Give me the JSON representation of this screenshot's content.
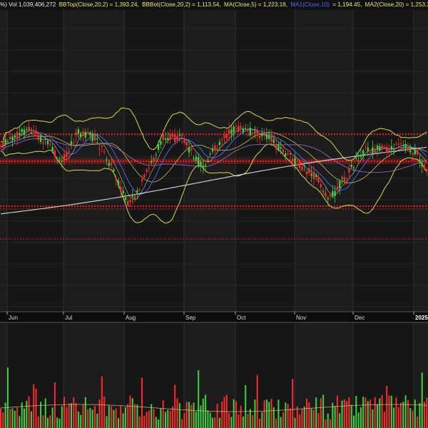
{
  "header": {
    "items": [
      {
        "text": "%) Vol 1,039,406,272",
        "color": "#e8e8e8"
      },
      {
        "text": "BBTop(Close,20,2) = 1,393.24,",
        "color": "#f0e66a"
      },
      {
        "text": "BBBot(Close,20,2) = 1,113.54,",
        "color": "#f0e66a"
      },
      {
        "text": "MA(Close,5) = 1,223.18,",
        "color": "#f0e66a"
      },
      {
        "text": "MA1(Close,10)",
        "color": "#4a6cff"
      },
      {
        "text": "= 1,194.45,",
        "color": "#f0e66a"
      },
      {
        "text": "MA2(Close,20) = 1,253.39,",
        "color": "#f0e66a"
      }
    ]
  },
  "colors": {
    "up": "#3bd23b",
    "down": "#ff2a2a",
    "bollinger": "#d8d64a",
    "ma5": "#ffffff",
    "ma10": "#4a6cff",
    "ma20": "#e7e26a",
    "ma_long": "#e8e8e8",
    "ma_purple": "#b07ad8",
    "level_band": "#ff2020"
  },
  "chart_data": {
    "type": "candlestick",
    "x_ticks": [
      {
        "label": "Jun",
        "bold": false
      },
      {
        "label": "Jul",
        "bold": false
      },
      {
        "label": "Aug",
        "bold": false
      },
      {
        "label": "Sep",
        "bold": false
      },
      {
        "label": "Oct",
        "bold": false
      },
      {
        "label": "Nov",
        "bold": false
      },
      {
        "label": "Dec",
        "bold": false
      },
      {
        "label": "2025",
        "bold": true
      }
    ],
    "grid": true,
    "indicators": [
      "BBTop(Close,20,2) = 1,393.24",
      "BBBot(Close,20,2) = 1,113.54",
      "MA(Close,5) = 1,223.18",
      "MA1(Close,10) = 1,194.45",
      "MA2(Close,20) = 1,253.39"
    ],
    "last_volume": "1,039,406,272"
  }
}
